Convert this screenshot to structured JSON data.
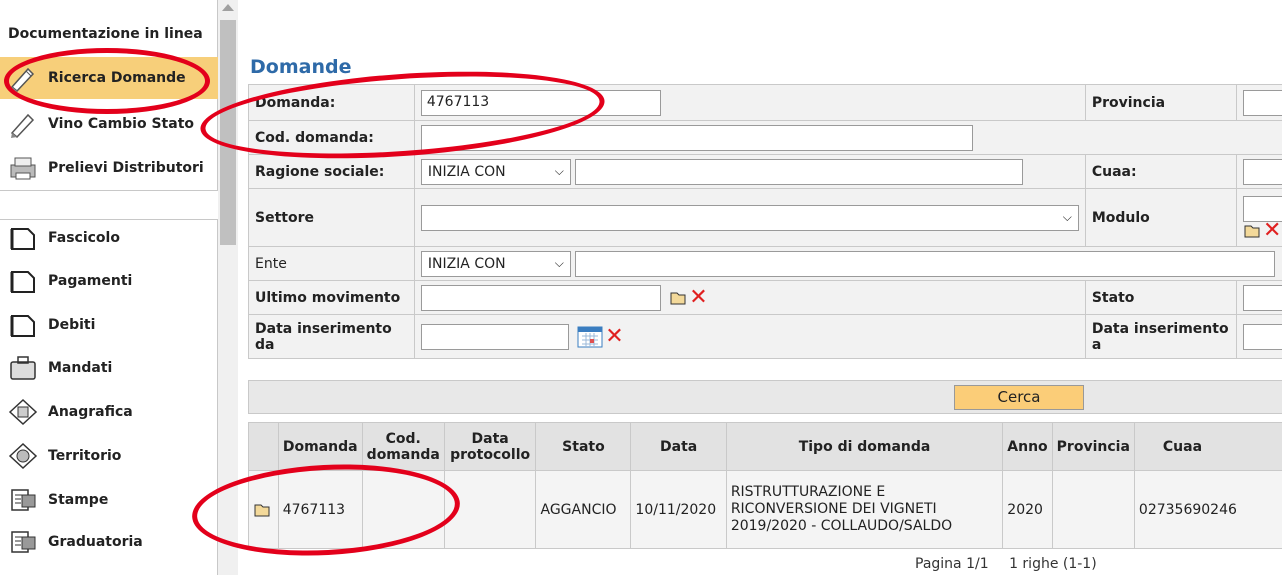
{
  "sidebar": {
    "doc_link": "Documentazione in linea",
    "items": [
      {
        "label": "Ricerca Domande",
        "icon": "pencil-icon"
      },
      {
        "label": "Vino Cambio Stato",
        "icon": "pencil-icon"
      },
      {
        "label": "Prelievi Distributori",
        "icon": "printer-icon"
      },
      {
        "label": "Fascicolo",
        "icon": "folder-icon"
      },
      {
        "label": "Pagamenti",
        "icon": "folder-icon"
      },
      {
        "label": "Debiti",
        "icon": "folder-icon"
      },
      {
        "label": "Mandati",
        "icon": "briefcase-icon"
      },
      {
        "label": "Anagrafica",
        "icon": "address-book-icon"
      },
      {
        "label": "Territorio",
        "icon": "globe-icon"
      },
      {
        "label": "Stampe",
        "icon": "print-report-icon"
      },
      {
        "label": "Graduatoria",
        "icon": "print-report-icon"
      }
    ]
  },
  "main": {
    "title": "Domande",
    "form": {
      "domanda_label": "Domanda:",
      "domanda_value": "4767113",
      "provincia_label": "Provincia",
      "cod_domanda_label": "Cod. domanda:",
      "ragione_label": "Ragione sociale:",
      "ragione_select": "INIZIA CON",
      "cuaa_label": "Cuaa:",
      "settore_label": "Settore",
      "modulo_label": "Modulo",
      "ente_label": "Ente",
      "ente_select": "INIZIA CON",
      "ultimo_label": "Ultimo movimento",
      "stato_label": "Stato",
      "data_da_label": "Data inserimento da",
      "data_a_label": "Data inserimento a",
      "cerca_label": "Cerca"
    },
    "results": {
      "headers": [
        "",
        "Domanda",
        "Cod. domanda",
        "Data protocollo",
        "Stato",
        "Data",
        "Tipo di domanda",
        "Anno",
        "Provincia",
        "Cuaa"
      ],
      "rows": [
        {
          "domanda": "4767113",
          "cod": "",
          "data_prot": "",
          "stato": "AGGANCIO",
          "data": "10/11/2020",
          "tipo": "RISTRUTTURAZIONE E RICONVERSIONE DEI VIGNETI 2019/2020 - COLLAUDO/SALDO",
          "anno": "2020",
          "provincia": "",
          "cuaa": "02735690246"
        }
      ]
    },
    "pager": {
      "pages": "Pagina 1/1",
      "rows": "1 righe (1-1)"
    }
  },
  "colors": {
    "accent_title": "#2e6aa8",
    "active_item": "#f7cf7a",
    "button": "#fbcd78",
    "annotation": "#e3001b"
  }
}
